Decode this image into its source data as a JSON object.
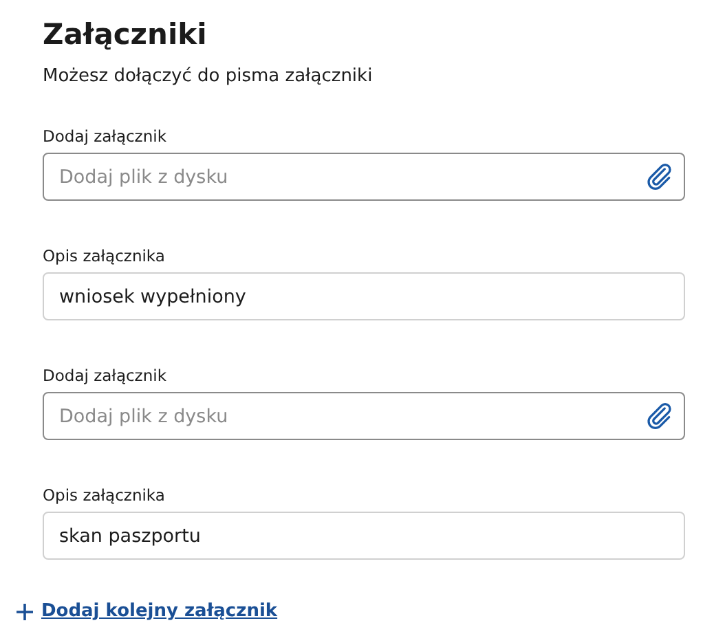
{
  "title": "Załączniki",
  "subtitle": "Możesz dołączyć do pisma załączniki",
  "fields": [
    {
      "kind": "file",
      "label": "Dodaj załącznik",
      "placeholder": "Dodaj plik z dysku"
    },
    {
      "kind": "text",
      "label": "Opis załącznika",
      "value": "wniosek wypełniony"
    },
    {
      "kind": "file",
      "label": "Dodaj załącznik",
      "placeholder": "Dodaj plik z dysku"
    },
    {
      "kind": "text",
      "label": "Opis załącznika",
      "value": "skan paszportu"
    }
  ],
  "add_link": "Dodaj kolejny załącznik"
}
